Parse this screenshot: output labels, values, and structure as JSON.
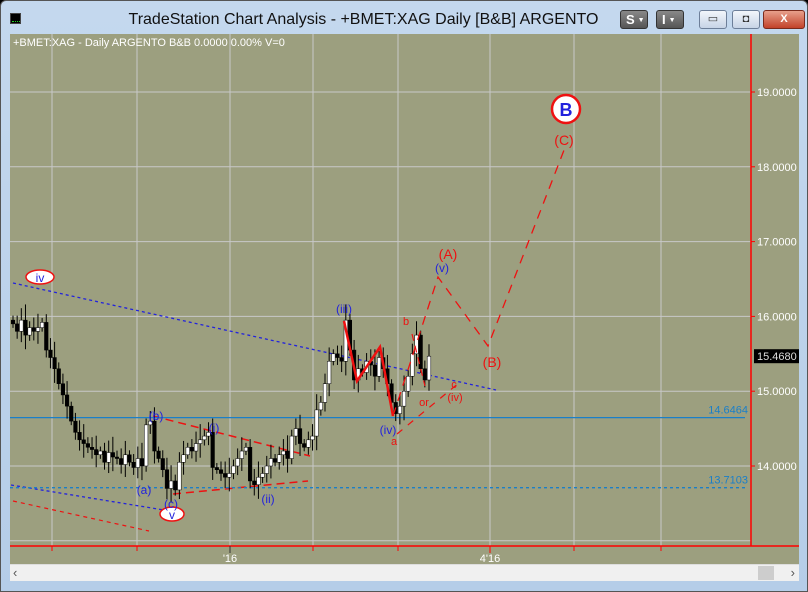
{
  "window": {
    "title": "TradeStation Chart Analysis - +BMET:XAG Daily [B&B] ARGENTO",
    "s_button": "S",
    "i_button": "I",
    "minimize": "▭",
    "restore": "◘",
    "close": "X"
  },
  "chart_header": "+BMET:XAG - Daily  ARGENTO  B&B  0.0000  0.00%  V=0",
  "chart_data": {
    "type": "candlestick",
    "symbol": "+BMET:XAG",
    "interval": "Daily",
    "ylim": [
      12.95,
      19.7
    ],
    "y_ticks": [
      "19.0000",
      "18.0000",
      "17.0000",
      "16.0000",
      "15.0000",
      "14.0000"
    ],
    "y_tick_values": [
      19,
      18,
      17,
      16,
      15,
      14
    ],
    "x_ticks": [
      "'16",
      "4'16"
    ],
    "last_price": "15.4680",
    "levels": [
      {
        "label": "14.6464",
        "value": 14.6464,
        "style": "solid"
      },
      {
        "label": "13.7103",
        "value": 13.7103,
        "style": "dashed"
      }
    ],
    "closes": [
      15.9,
      15.8,
      15.95,
      15.75,
      15.85,
      15.8,
      15.85,
      15.92,
      15.55,
      15.45,
      15.3,
      15.1,
      14.95,
      14.8,
      14.6,
      14.45,
      14.35,
      14.3,
      14.25,
      14.22,
      14.15,
      14.2,
      14.05,
      14.18,
      14.12,
      14.1,
      14.02,
      14.15,
      14.05,
      13.98,
      14.1,
      14.0,
      14.55,
      14.6,
      14.2,
      14.1,
      13.95,
      13.7,
      13.8,
      13.68,
      14.05,
      14.15,
      14.25,
      14.2,
      14.3,
      14.35,
      14.4,
      14.45,
      13.98,
      13.95,
      13.9,
      13.85,
      13.9,
      14.0,
      14.1,
      14.2,
      14.25,
      13.8,
      13.75,
      13.85,
      13.9,
      14.0,
      14.1,
      14.05,
      14.15,
      14.2,
      14.1,
      14.4,
      14.5,
      14.3,
      14.25,
      14.35,
      14.4,
      14.75,
      14.85,
      15.1,
      15.4,
      15.5,
      15.45,
      15.4,
      15.95,
      15.55,
      15.15,
      15.3,
      15.25,
      15.4,
      15.35,
      15.2,
      15.45,
      15.3,
      15.1,
      14.85,
      14.7,
      14.8,
      15.0,
      15.2,
      15.5,
      15.75,
      15.3,
      15.15,
      15.468
    ]
  },
  "wave_labels": {
    "iv_circle": "iv",
    "v_circle": "v",
    "b_circle": "B",
    "A": "(A)",
    "B": "(B)",
    "C": "(C)",
    "v": "(v)",
    "iii": "(iii)",
    "iv": "(iv)",
    "a_small": "a",
    "b_small": "b",
    "or": "or",
    "c_small": "c",
    "iv_alt": "(iv)",
    "b": "(b)",
    "a": "(a)",
    "c": "(c)",
    "i": "(i)",
    "ii": "(ii)"
  },
  "colors": {
    "background": "#9c9f7f",
    "axis": "#ff0000",
    "wave_blue": "#2222dd",
    "wave_red": "#ee1111",
    "level": "#1a7fc8"
  }
}
